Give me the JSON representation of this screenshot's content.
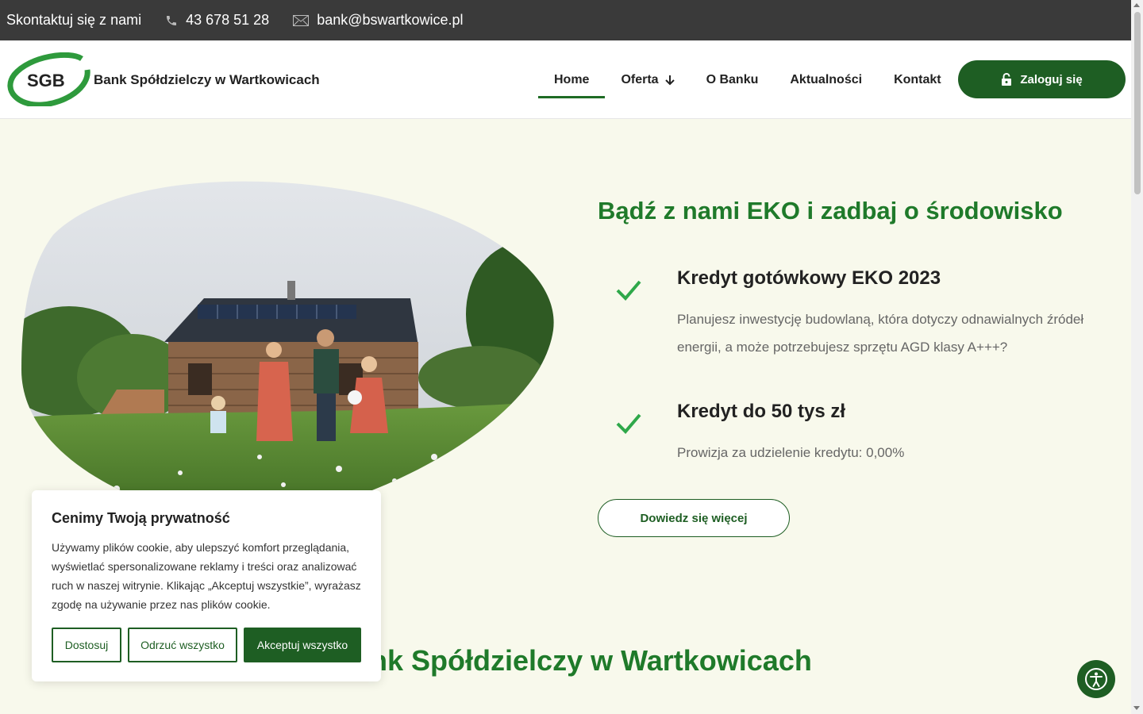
{
  "topbar": {
    "contact_label": "Skontaktuj się z nami",
    "phone": "43 678 51 28",
    "email": "bank@bswartkowice.pl"
  },
  "header": {
    "logo_text": "SGB",
    "bank_name": "Bank Spółdzielczy w Wartkowicach",
    "nav": [
      {
        "label": "Home"
      },
      {
        "label": "Oferta"
      },
      {
        "label": "O Banku"
      },
      {
        "label": "Aktualności"
      },
      {
        "label": "Kontakt"
      }
    ],
    "login_label": "Zaloguj się"
  },
  "hero": {
    "title": "Bądź z nami EKO i zadbaj o środowisko",
    "features": [
      {
        "title": "Kredyt gotówkowy EKO 2023",
        "description": "Planujesz inwestycję budowlaną, która dotyczy odnawialnych źródeł energii, a może potrzebujesz sprzętu AGD klasy A+++?"
      },
      {
        "title": "Kredyt do 50 tys zł",
        "description": "Prowizja za udzielenie kredytu: 0,00%"
      }
    ],
    "more_label": "Dowiedz się więcej"
  },
  "section": {
    "title": "Bank Spółdzielczy w Wartkowicach"
  },
  "cookie": {
    "title": "Cenimy Twoją prywatność",
    "text": "Używamy plików cookie, aby ulepszyć komfort przeglądania, wyświetlać spersonalizowane reklamy i treści oraz analizować ruch w naszej witrynie. Klikając „Akceptuj wszystkie”, wyrażasz zgodę na używanie przez nas plików cookie.",
    "customize_label": "Dostosuj",
    "reject_label": "Odrzuć wszystko",
    "accept_label": "Akceptuj wszystko"
  },
  "colors": {
    "brand_green": "#1e5e23",
    "title_green": "#1f7a2a",
    "check_green": "#2fa84a",
    "background": "#f8f9ec"
  }
}
